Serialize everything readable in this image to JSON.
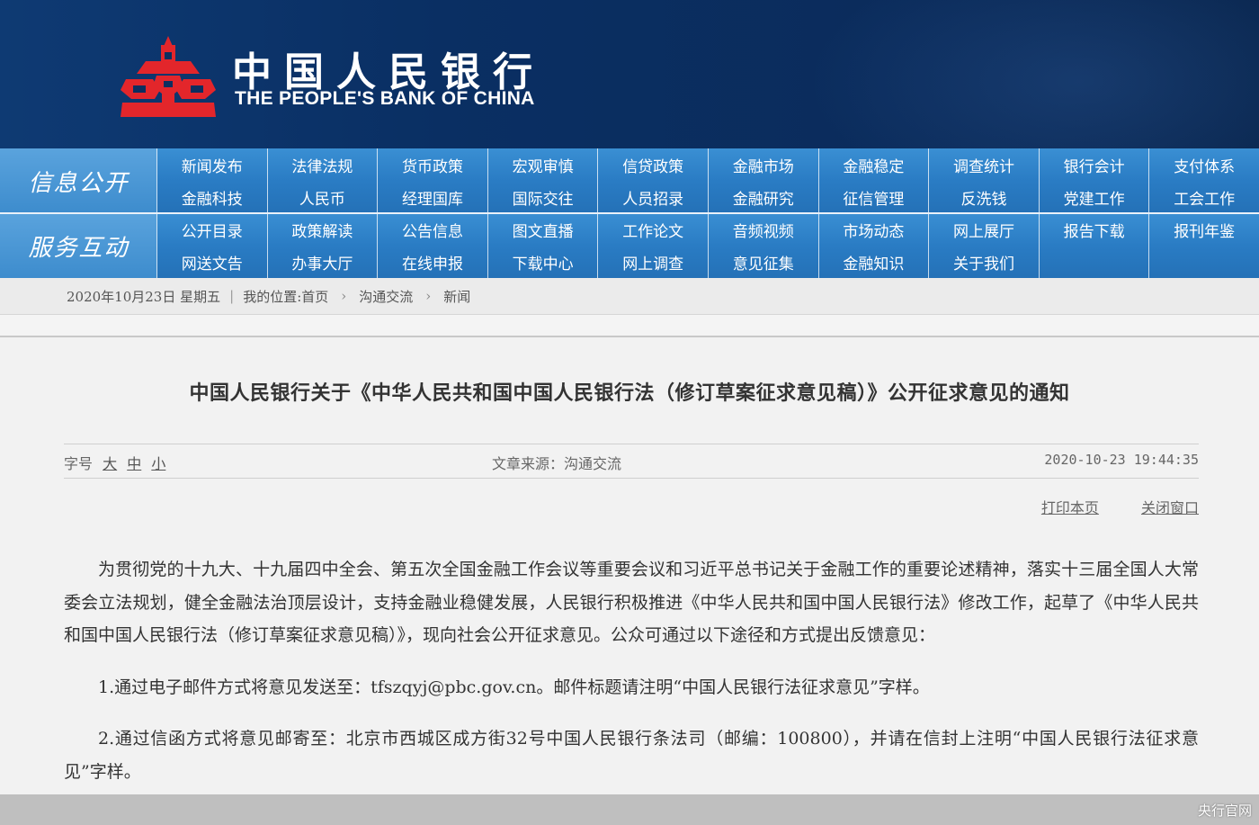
{
  "header": {
    "brand_cn": "中国人民银行",
    "brand_en": "THE PEOPLE'S BANK OF CHINA",
    "logo_color": "#e3262b"
  },
  "nav": {
    "section1": {
      "label": "信息公开",
      "items": [
        "新闻发布",
        "法律法规",
        "货币政策",
        "宏观审慎",
        "信贷政策",
        "金融市场",
        "金融稳定",
        "调查统计",
        "银行会计",
        "支付体系",
        "金融科技",
        "人民币",
        "经理国库",
        "国际交往",
        "人员招录",
        "金融研究",
        "征信管理",
        "反洗钱",
        "党建工作",
        "工会工作"
      ]
    },
    "section2": {
      "label": "服务互动",
      "items": [
        "公开目录",
        "政策解读",
        "公告信息",
        "图文直播",
        "工作论文",
        "音频视频",
        "市场动态",
        "网上展厅",
        "报告下载",
        "报刊年鉴",
        "网送文告",
        "办事大厅",
        "在线申报",
        "下载中心",
        "网上调查",
        "意见征集",
        "金融知识",
        "关于我们",
        "",
        ""
      ]
    }
  },
  "breadcrumb": {
    "date": "2020年10月23日",
    "weekday": "星期五",
    "location_label": "我的位置:首页",
    "level1": "沟通交流",
    "level2": "新闻"
  },
  "article": {
    "title": "中国人民银行关于《中华人民共和国中国人民银行法（修订草案征求意见稿）》公开征求意见的通知",
    "font_size_label": "字号",
    "font_size_large": "大",
    "font_size_medium": "中",
    "font_size_small": "小",
    "source": "文章来源：沟通交流",
    "datetime": "2020-10-23 19:44:35",
    "print_label": "打印本页",
    "close_label": "关闭窗口",
    "paragraph1": "为贯彻党的十九大、十九届四中全会、第五次全国金融工作会议等重要会议和习近平总书记关于金融工作的重要论述精神，落实十三届全国人大常委会立法规划，健全金融法治顶层设计，支持金融业稳健发展，人民银行积极推进《中华人民共和国中国人民银行法》修改工作，起草了《中华人民共和国中国人民银行法（修订草案征求意见稿）》，现向社会公开征求意见。公众可通过以下途径和方式提出反馈意见：",
    "item1": "1.通过电子邮件方式将意见发送至：tfszqyj@pbc.gov.cn。邮件标题请注明“中国人民银行法征求意见”字样。",
    "item2": "2.通过信函方式将意见邮寄至：北京市西城区成方街32号中国人民银行条法司（邮编：100800），并请在信封上注明“中国人民银行法征求意见”字样。"
  },
  "watermark": "央行官网"
}
